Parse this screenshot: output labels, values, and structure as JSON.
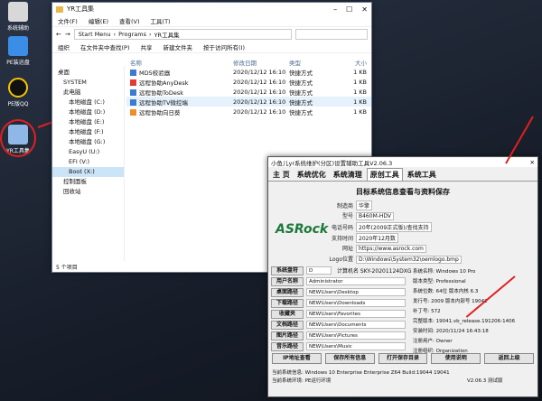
{
  "desktop": {
    "icons": [
      {
        "label": "系统辅助"
      },
      {
        "label": "PE装迅盘"
      },
      {
        "label": "PE版QQ"
      },
      {
        "label": "YR工具集"
      }
    ]
  },
  "explorer": {
    "title": "YR工具集",
    "menu": [
      "文件(F)",
      "编辑(E)",
      "查看(V)",
      "工具(T)"
    ],
    "path": [
      "Start Menu",
      "Programs",
      "YR工具集"
    ],
    "toolbar": [
      "组织",
      "在文件夹中查找(P)",
      "共享",
      "新建文件夹",
      "按于访问所有(I)"
    ],
    "nav": [
      "桌面",
      "SYSTEM",
      "此电脑",
      "本地磁盘 (C:)",
      "本地磁盘 (D:)",
      "本地磁盘 (E:)",
      "本地磁盘 (F:)",
      "本地磁盘 (G:)",
      "EasyU (U:)",
      "EFI (V:)",
      "Boot (X:)",
      "控制面板",
      "回收站"
    ],
    "columns": [
      "名称",
      "修改日期",
      "类型",
      "大小"
    ],
    "files": [
      {
        "name": "MD5校验器",
        "date": "2020/12/12 16:10",
        "type": "快捷方式",
        "size": "1 KB"
      },
      {
        "name": "远程协助AnyDesk",
        "date": "2020/12/12 16:10",
        "type": "快捷方式",
        "size": "1 KB"
      },
      {
        "name": "远程协助ToDesk",
        "date": "2020/12/12 16:10",
        "type": "快捷方式",
        "size": "1 KB"
      },
      {
        "name": "远程协助TV微控端",
        "date": "2020/12/12 16:10",
        "type": "快捷方式",
        "size": "1 KB"
      },
      {
        "name": "远程协助向日葵",
        "date": "2020/12/12 16:10",
        "type": "快捷方式",
        "size": "1 KB"
      }
    ],
    "status": "5 个项目"
  },
  "systool": {
    "title": "小鱼儿yr系统维护(分区)设置辅助工具V2.06.3",
    "tabs": [
      "主 页",
      "系统优化",
      "系统清理",
      "原创工具",
      "系统工具"
    ],
    "heading": "目标系统信息查看与资料保存",
    "logo": "ASRock",
    "info": [
      {
        "k": "制造商",
        "v": "华擎"
      },
      {
        "k": "型号",
        "v": "B460M-HDV"
      },
      {
        "k": "电话号码",
        "v": "20年(2009正式版)/查找支持"
      },
      {
        "k": "支持时间",
        "v": "2020年12月数"
      },
      {
        "k": "网址",
        "v": "https://www.asrock.com"
      },
      {
        "k": "Logo位置",
        "v": "D:\\Windows\\System32\\oemlogo.bmp"
      }
    ],
    "left_labels": [
      "系统盘符",
      "用户名称",
      "桌面路径",
      "下载路径",
      "收藏夹",
      "文档路径",
      "图片路径",
      "音乐路径",
      "视频路径"
    ],
    "left_values": [
      "D",
      "Administrator",
      "NEW\\Users\\Desktop",
      "NEW\\Users\\Downloads",
      "NEW\\Users\\Favorites",
      "NEW\\Users\\Documents",
      "NEW\\Users\\Pictures",
      "NEW\\Users\\Music",
      "NEW\\Users\\Videos"
    ],
    "computer_name": "计算机名 SKY-20201124DXG",
    "right": [
      {
        "k": "系统名称",
        "v": "Windows 10 Pro"
      },
      {
        "k": "版本类型",
        "v": "Professional"
      },
      {
        "k": "系统位数",
        "v": "64位    版本内核 6.3"
      },
      {
        "k": "发行号",
        "v": "2009    版本内部号 19042"
      },
      {
        "k": "补丁号",
        "v": "572"
      },
      {
        "k": "完整版本",
        "v": "19041.vb_release.191206-1406"
      },
      {
        "k": "安装时间",
        "v": "2020/11/24 16:43:18"
      },
      {
        "k": "注册用户",
        "v": "Owner"
      },
      {
        "k": "注册组织",
        "v": "Organization"
      }
    ],
    "buttons": [
      "IP地址查看",
      "保存所有信息",
      "打开保存目录",
      "使用说明",
      "返回上级"
    ],
    "status1": "当前系统信息: Windows 10 Enterprise Enterprise Z64 Build:19044 19041",
    "status2": "当前系统环境: PE运行环境",
    "version": "V2.06.3 测试版"
  }
}
